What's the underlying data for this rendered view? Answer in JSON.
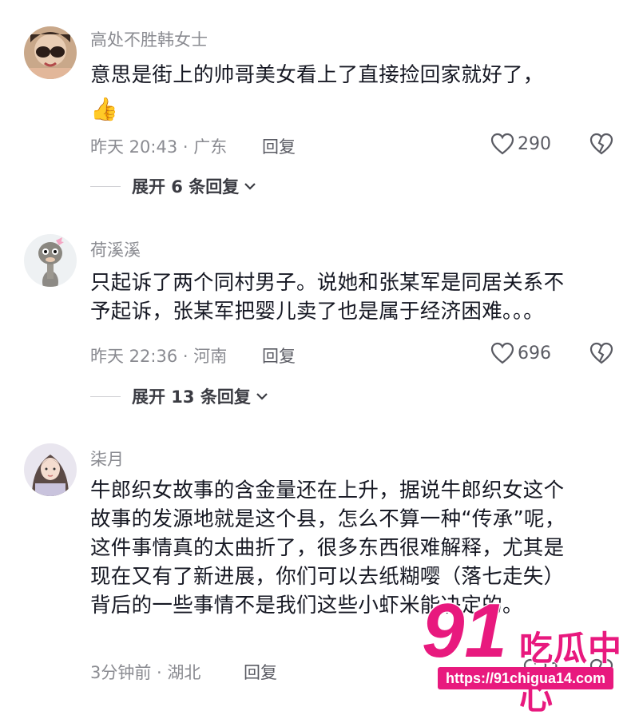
{
  "comments": [
    {
      "username": "高处不胜韩女士",
      "lines": [
        "意思是街上的帅哥美女看上了直接捡回家就好了，"
      ],
      "emoji": "👍",
      "meta": "昨天 20:43 · 广东",
      "reply_label": "回复",
      "likes": "290",
      "expand_label": "展开 6 条回复"
    },
    {
      "username": "荷溪溪",
      "lines": [
        "只起诉了两个同村男子。说她和张某军是同居关系不",
        "予起诉，张某军把婴儿卖了也是属于经济困难。。。"
      ],
      "meta": "昨天 22:36 · 河南",
      "reply_label": "回复",
      "likes": "696",
      "expand_label": "展开 13 条回复"
    },
    {
      "username": "柒月",
      "lines": [
        "牛郎织女故事的含金量还在上升，据说牛郎织女这个",
        "故事的发源地就是这个县，怎么不算一种“传承”呢，",
        "这件事情真的太曲折了，很多东西很难解释，尤其是",
        "现在又有了新进展，你们可以去纸糊嘤（落七走失）",
        "背后的一些事情不是我们这些小虾米能决定的。"
      ],
      "meta": "3分钟前 · 湖北",
      "reply_label": "回复",
      "likes": "1"
    }
  ],
  "watermark": {
    "number": "91",
    "title": "吃瓜中心",
    "url": "https://91chigua14.com"
  },
  "colors": {
    "accent": "#e8197e",
    "muted": "#8a8b91",
    "text": "#161823"
  }
}
